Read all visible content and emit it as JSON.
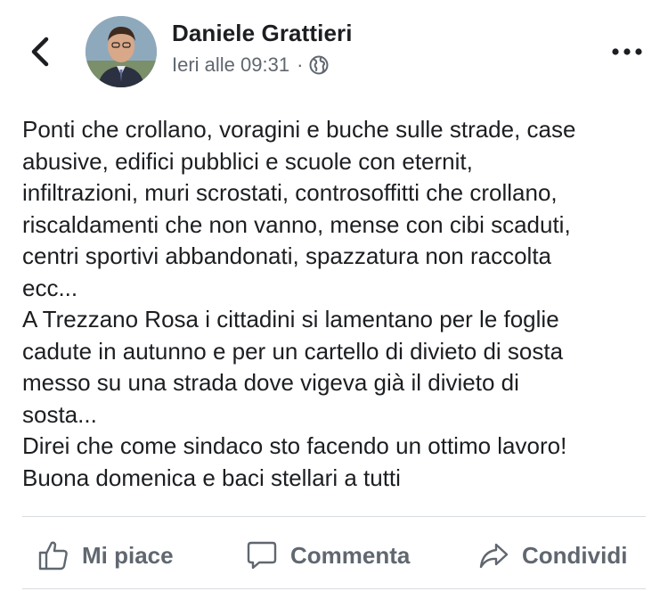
{
  "header": {
    "author_name": "Daniele Grattieri",
    "timestamp": "Ieri alle 09:31",
    "separator": "·",
    "privacy_icon": "globe-icon",
    "back_icon": "chevron-left-icon",
    "more_icon": "more-dots-icon"
  },
  "post": {
    "lines": [
      "Ponti che crollano, voragini e buche sulle strade, case",
      "abusive, edifici pubblici e scuole con eternit,",
      "infiltrazioni, muri scrostati, controsoffitti che crollano,",
      "riscaldamenti che non vanno, mense con cibi scaduti,",
      "centri sportivi abbandonati, spazzatura non raccolta",
      "ecc...",
      "A Trezzano Rosa i cittadini si lamentano per le foglie",
      "cadute in autunno e per un cartello di divieto di sosta",
      "messo su una strada dove vigeva già il divieto di",
      "sosta...",
      "Direi che come sindaco sto facendo un ottimo lavoro!",
      "Buona domenica e baci stellari a tutti"
    ]
  },
  "actions": {
    "like_label": "Mi piace",
    "comment_label": "Commenta",
    "share_label": "Condividi"
  },
  "colors": {
    "text": "#1c1e21",
    "secondary_text": "#606770",
    "divider": "#dadde1"
  }
}
